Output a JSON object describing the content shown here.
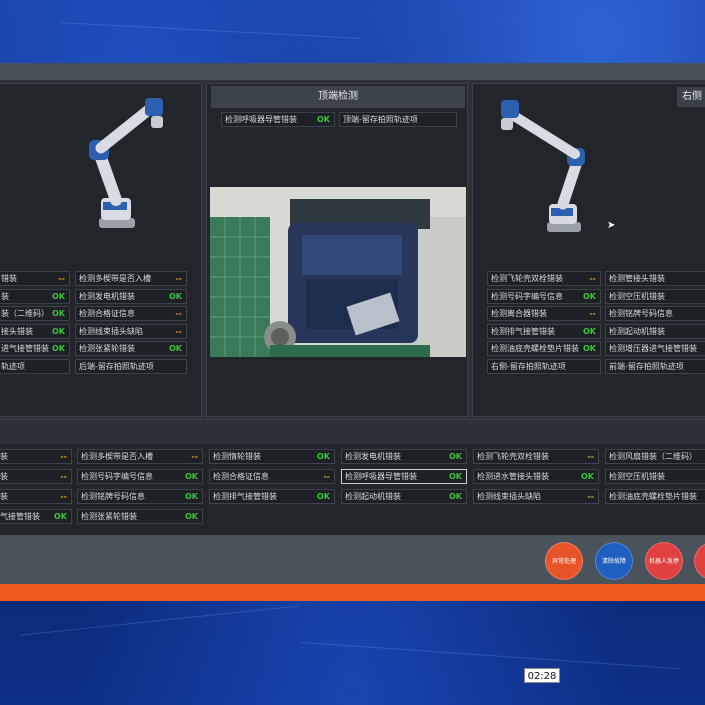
{
  "panels": {
    "middle_title": "顶端检测",
    "right_title_partial": "右侧"
  },
  "left_items": [
    {
      "label": "错装",
      "status": "--"
    },
    {
      "label": "检测多楔带是否入槽",
      "status": "--"
    },
    {
      "label": "装",
      "status": "OK"
    },
    {
      "label": "检测发电机错装",
      "status": "OK"
    },
    {
      "label": "装（二维码）",
      "status": "OK"
    },
    {
      "label": "检测合格证信息",
      "status": "--"
    },
    {
      "label": "接头错装",
      "status": "OK"
    },
    {
      "label": "检测线束插头缺陷",
      "status": "--"
    },
    {
      "label": "进气接管错装",
      "status": "OK"
    },
    {
      "label": "检测张紧轮错装",
      "status": "OK"
    },
    {
      "label": "轨迹项",
      "status": ""
    },
    {
      "label": "后端-留存拍照轨迹项",
      "status": ""
    }
  ],
  "middle_items": [
    {
      "label": "检测呼吸器导管错装",
      "status": "OK"
    },
    {
      "label": "顶端-留存拍照轨迹项",
      "status": ""
    }
  ],
  "right_items": [
    {
      "label": "检测飞轮壳双栓错装",
      "status": "--"
    },
    {
      "label": "检测管接头错装",
      "status": ""
    },
    {
      "label": "检测号码字编号信息",
      "status": "OK"
    },
    {
      "label": "检测空压机错装",
      "status": ""
    },
    {
      "label": "检测离合器错装",
      "status": "--"
    },
    {
      "label": "检测铭牌号码信息",
      "status": ""
    },
    {
      "label": "检测排气接管错装",
      "status": "OK"
    },
    {
      "label": "检测起动机错装",
      "status": ""
    },
    {
      "label": "检测油底壳螺栓垫片错装",
      "status": "OK"
    },
    {
      "label": "检测增压器进气接管错装",
      "status": ""
    },
    {
      "label": "右侧-留存拍照轨迹项",
      "status": ""
    },
    {
      "label": "前端-留存拍照轨迹项",
      "status": ""
    }
  ],
  "lower_columns": [
    [
      {
        "label": "装",
        "status": "--"
      },
      {
        "label": "装",
        "status": "--"
      },
      {
        "label": "装",
        "status": "--"
      },
      {
        "label": "气接管错装",
        "status": "OK"
      }
    ],
    [
      {
        "label": "检测多楔带是否入槽",
        "status": "--"
      },
      {
        "label": "检测号码字编号信息",
        "status": "OK"
      },
      {
        "label": "检测铭牌号码信息",
        "status": "OK"
      },
      {
        "label": "检测张紧轮错装",
        "status": "OK"
      }
    ],
    [
      {
        "label": "检测惰轮错装",
        "status": "OK"
      },
      {
        "label": "检测合格证信息",
        "status": "--"
      },
      {
        "label": "检测排气接管错装",
        "status": "OK"
      }
    ],
    [
      {
        "label": "检测发电机错装",
        "status": "OK"
      },
      {
        "label": "检测呼吸器导管错装",
        "status": "OK"
      },
      {
        "label": "检测起动机错装",
        "status": "OK"
      }
    ],
    [
      {
        "label": "检测飞轮壳双栓错装",
        "status": "--"
      },
      {
        "label": "检测进水管接头错装",
        "status": "OK"
      },
      {
        "label": "检测线束插头缺陷",
        "status": "--"
      }
    ],
    [
      {
        "label": "检测风扇错装（二维码）",
        "status": ""
      },
      {
        "label": "检测空压机错装",
        "status": ""
      },
      {
        "label": "检测油底壳螺栓垫片错装",
        "status": ""
      }
    ]
  ],
  "footer_buttons": [
    {
      "label": "异常处理",
      "color": "#e8542a"
    },
    {
      "label": "清除故障",
      "color": "#1f5fc0"
    },
    {
      "label": "机器人急停",
      "color": "#e04040"
    },
    {
      "label": "急",
      "color": "#e04040"
    }
  ],
  "clock": "02:28",
  "colors": {
    "ok": "#3cc43c",
    "dash": "#e0a030",
    "accent": "#ee5b1c"
  }
}
